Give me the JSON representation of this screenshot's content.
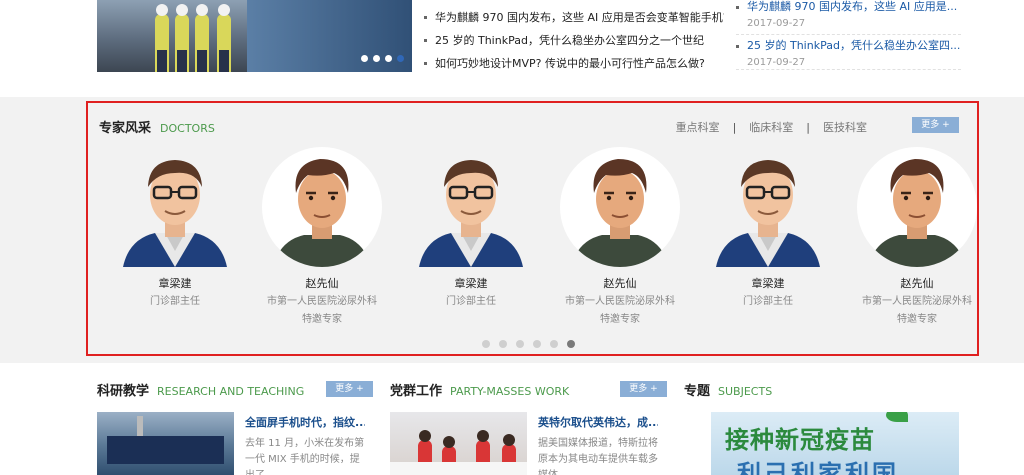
{
  "top": {
    "slider_dot_count": 4,
    "slider_active_dot": 3,
    "news": [
      "华为麒麟 970 国内发布，这些 AI 应用是否会变革智能手机?",
      "25 岁的 ThinkPad，凭什么稳坐办公室四分之一个世纪",
      "如何巧妙地设计MVP? 传说中的最小可行性产品怎么做?"
    ],
    "right_news": [
      {
        "title": "华为麒麟 970 国内发布，这些 AI 应用是...",
        "date": "2017-09-27"
      },
      {
        "title": "25 岁的 ThinkPad，凭什么稳坐办公室四...",
        "date": "2017-09-27"
      }
    ]
  },
  "doctors": {
    "title_cn": "专家风采",
    "title_en": "DOCTORS",
    "tabs": [
      "重点科室",
      "临床科室",
      "医技科室"
    ],
    "more": "更多 +",
    "items": [
      {
        "name": "章梁建",
        "title": "门诊部主任",
        "title2": "",
        "avatar": "glasses-man"
      },
      {
        "name": "赵先仙",
        "title": "市第一人民医院泌尿外科",
        "title2": "特邀专家",
        "avatar": "young-man"
      },
      {
        "name": "章梁建",
        "title": "门诊部主任",
        "title2": "",
        "avatar": "glasses-man"
      },
      {
        "name": "赵先仙",
        "title": "市第一人民医院泌尿外科",
        "title2": "特邀专家",
        "avatar": "young-man"
      },
      {
        "name": "章梁建",
        "title": "门诊部主任",
        "title2": "",
        "avatar": "glasses-man"
      },
      {
        "name": "赵先仙",
        "title": "市第一人民医院泌尿外科",
        "title2": "特邀专家",
        "avatar": "young-man"
      }
    ],
    "pager_count": 6,
    "pager_active": 5
  },
  "research": {
    "title_cn": "科研教学",
    "title_en": "RESEARCH AND TEACHING",
    "more": "更多 +",
    "news_title": "全面屏手机时代，指纹...",
    "news_desc": "去年 11 月，小米在发布第一代 MIX 手机的时候，提出了"
  },
  "party": {
    "title_cn": "党群工作",
    "title_en": "PARTY-MASSES WORK",
    "more": "更多 +",
    "news_title": "英特尔取代英伟达，成...",
    "news_desc": "据美国媒体报道，特斯拉将原本为其电动车提供车载多媒体"
  },
  "subjects": {
    "title_cn": "专题",
    "title_en": "SUBJECTS",
    "poster_line1": "接种新冠疫苗",
    "poster_line2": "利己利家利国"
  },
  "colors": {
    "accent_blue": "#8aaed6",
    "accent_green": "#4c9a4c",
    "highlight_red": "#e02020"
  }
}
